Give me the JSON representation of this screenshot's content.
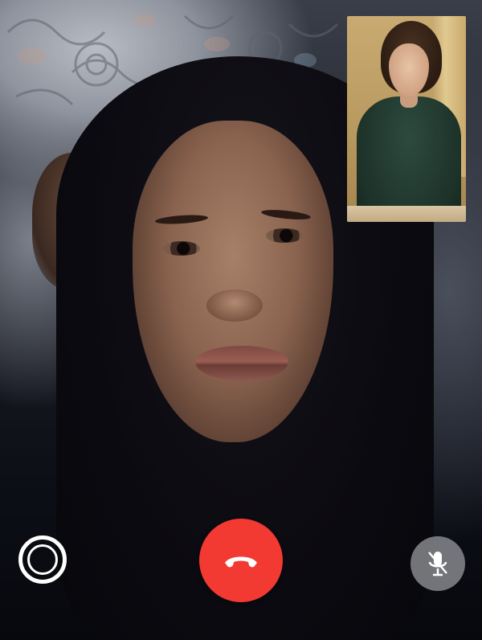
{
  "call": {
    "state": "in-call",
    "remote_feed": "main-video",
    "local_feed": "self-view"
  },
  "controls": {
    "capture_icon": "camera-shutter-icon",
    "end_call_icon": "phone-hangup-icon",
    "mute_icon": "microphone-muted-icon",
    "mic_muted": true
  },
  "colors": {
    "end_call": "#f23a32",
    "capture_ring": "#ffffff",
    "mute_bg": "#b4b6bc",
    "icon": "#ffffff"
  }
}
